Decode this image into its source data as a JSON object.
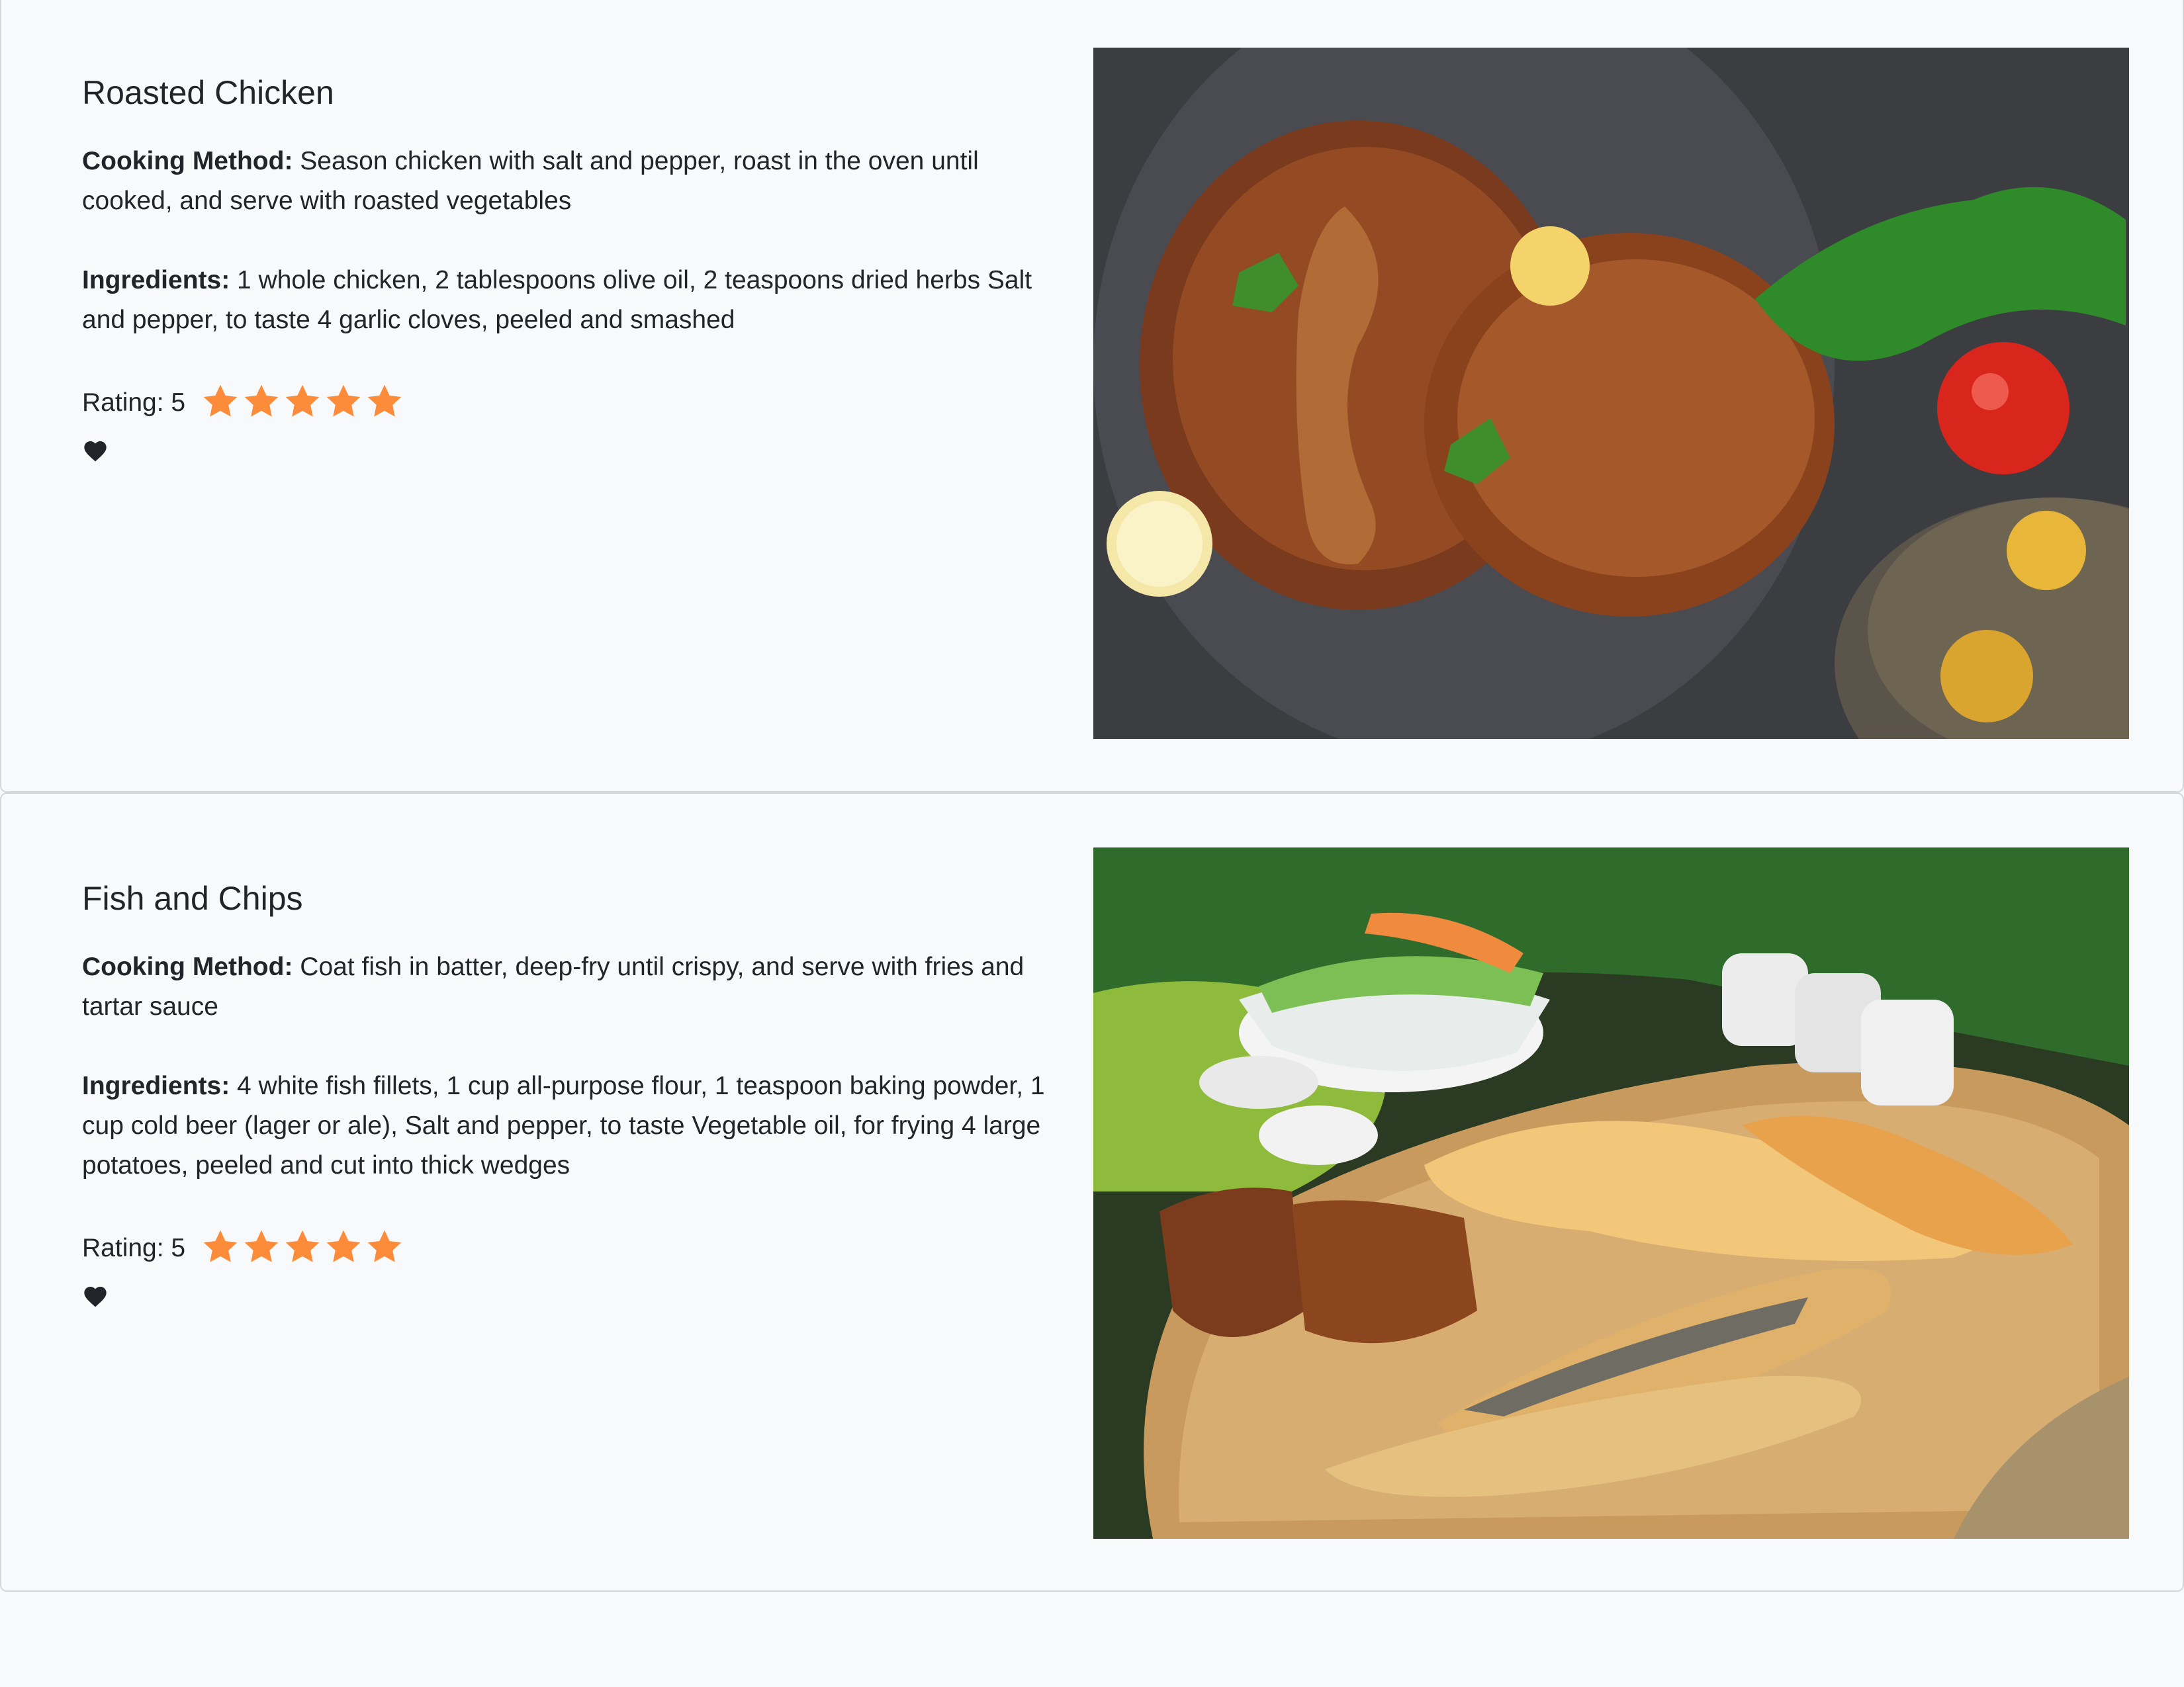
{
  "recipes": [
    {
      "title": "Roasted Chicken",
      "cooking_method_label": "Cooking Method:",
      "cooking_method": " Season chicken with salt and pepper, roast in the oven until cooked, and serve with roasted vegetables",
      "ingredients_label": "Ingredients:",
      "ingredients": " 1 whole chicken, 2 tablespoons olive oil, 2 teaspoons dried herbs Salt and pepper, to taste 4 garlic cloves, peeled and smashed",
      "rating_label": "Rating: 5",
      "rating": 5,
      "stars": [
        1,
        2,
        3,
        4,
        5
      ],
      "favorite_icon": "heart-icon",
      "image": "photo of roasted chicken"
    },
    {
      "title": "Fish and Chips",
      "cooking_method_label": "Cooking Method:",
      "cooking_method": " Coat fish in batter, deep-fry until crispy, and serve with fries and tartar sauce",
      "ingredients_label": "Ingredients:",
      "ingredients": " 4 white fish fillets, 1 cup all-purpose flour, 1 teaspoon baking powder, 1 cup cold beer (lager or ale), Salt and pepper, to taste Vegetable oil, for frying 4 large potatoes, peeled and cut into thick wedges",
      "rating_label": "Rating: 5",
      "rating": 5,
      "stars": [
        1,
        2,
        3,
        4,
        5
      ],
      "favorite_icon": "heart-icon",
      "image": "photo of fish and chips"
    }
  ],
  "colors": {
    "page_background": "#f8f9fb",
    "card_border": "#d4d7db",
    "text": "#212529",
    "star": "#fd8c3a",
    "heart": "#212529"
  }
}
